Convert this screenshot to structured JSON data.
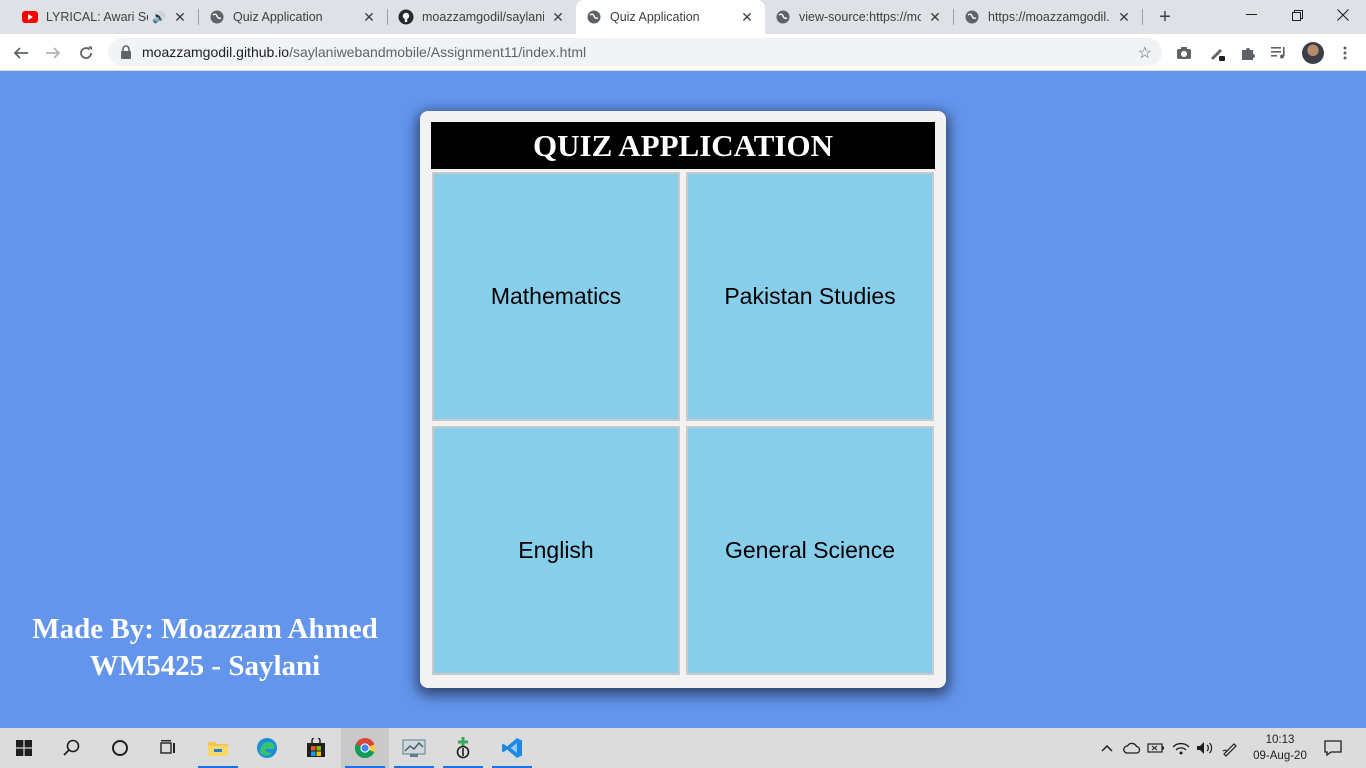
{
  "browser": {
    "tabs": [
      {
        "title": "LYRICAL: Awari Son",
        "icon": "youtube-icon",
        "audio": true
      },
      {
        "title": "Quiz Application",
        "icon": "globe-icon"
      },
      {
        "title": "moazzamgodil/saylaniw",
        "icon": "github-icon"
      },
      {
        "title": "Quiz Application",
        "icon": "globe-icon",
        "active": true
      },
      {
        "title": "view-source:https://moa",
        "icon": "globe-icon"
      },
      {
        "title": "https://moazzamgodil.g",
        "icon": "globe-icon"
      }
    ],
    "url_host": "moazzamgodil.github.io",
    "url_path": "/saylaniwebandmobile/Assignment11/index.html"
  },
  "page": {
    "header_title": "QUIZ APPLICATION",
    "subjects": [
      "Mathematics",
      "Pakistan Studies",
      "English",
      "General Science"
    ],
    "credit_line1": "Made By: Moazzam Ahmed",
    "credit_line2": "WM5425 - Saylani",
    "colors": {
      "background": "#6495ed",
      "tile": "#87ceeb",
      "header": "#000000"
    }
  },
  "taskbar": {
    "time": "10:13",
    "date": "09-Aug-20"
  }
}
